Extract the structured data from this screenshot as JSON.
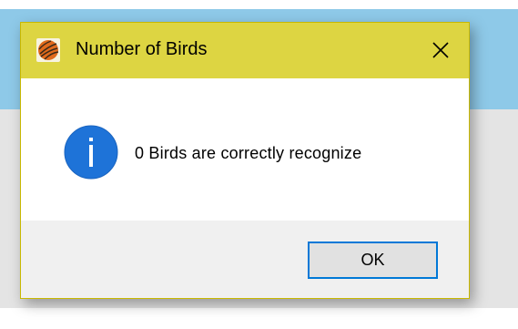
{
  "dialog": {
    "title": "Number of Birds",
    "message": "0 Birds are correctly recognize",
    "ok_label": "OK",
    "icons": {
      "app": "app-logo-icon",
      "close": "close-icon",
      "info": "info-icon"
    }
  },
  "colors": {
    "titlebar": "#ddd542",
    "info_icon": "#1e73d8",
    "button_focus_border": "#0078d7",
    "background_banner": "#8ec9e8"
  }
}
